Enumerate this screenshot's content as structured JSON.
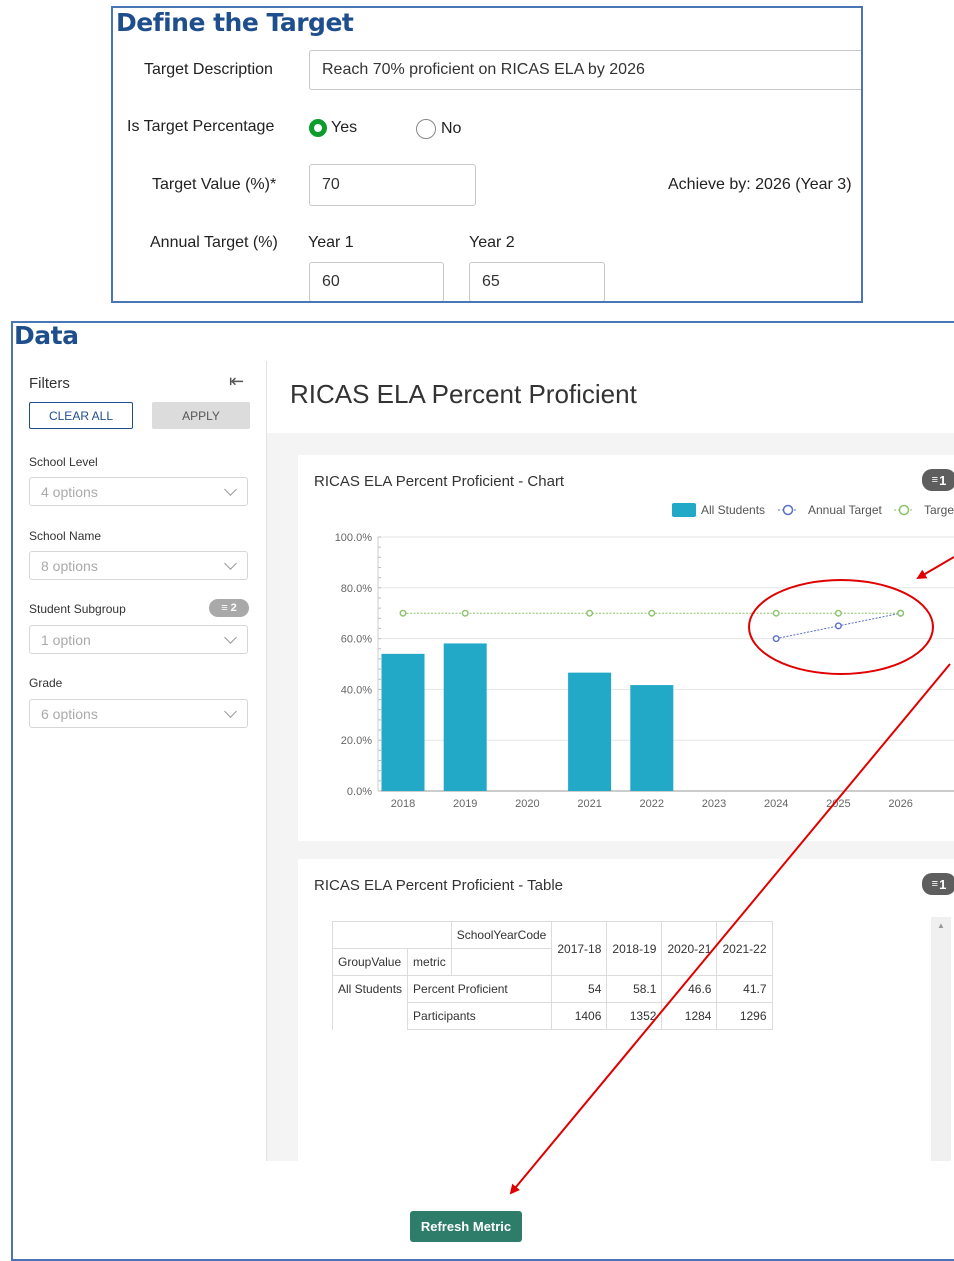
{
  "target": {
    "heading": "Define the Target",
    "description_label": "Target Description",
    "description_value": "Reach 70% proficient on RICAS ELA by 2026",
    "percentage_label": "Is Target Percentage",
    "yes_label": "Yes",
    "no_label": "No",
    "selected": "Yes",
    "value_label": "Target Value (%)*",
    "value": "70",
    "achieve_by": "Achieve by: 2026 (Year 3)",
    "annual_label": "Annual Target (%)",
    "years": [
      {
        "label": "Year 1",
        "value": "60"
      },
      {
        "label": "Year 2",
        "value": "65"
      }
    ]
  },
  "data_section": {
    "heading": "Data",
    "filters": {
      "title": "Filters",
      "clear_all": "CLEAR ALL",
      "apply": "APPLY",
      "groups": [
        {
          "label": "School Level",
          "value": "4 options"
        },
        {
          "label": "School Name",
          "value": "8 options"
        },
        {
          "label": "Student Subgroup",
          "value": "1 option",
          "badge": "2"
        },
        {
          "label": "Grade",
          "value": "6 options"
        }
      ]
    },
    "page_title": "RICAS ELA Percent Proficient",
    "chart_title": "RICAS ELA Percent Proficient - Chart",
    "chart_filter_count": "1",
    "table_title": "RICAS ELA Percent Proficient - Table",
    "table_filter_count": "1",
    "table": {
      "corner_header": "SchoolYearCode",
      "row_headers": [
        "GroupValue",
        "metric"
      ],
      "columns": [
        "2017-18",
        "2018-19",
        "2020-21",
        "2021-22"
      ],
      "group": "All Students",
      "rows": [
        {
          "metric": "Percent Proficient",
          "values": [
            "54",
            "58.1",
            "46.6",
            "41.7"
          ]
        },
        {
          "metric": "Participants",
          "values": [
            "1406",
            "1352",
            "1284",
            "1296"
          ]
        }
      ]
    },
    "refresh_label": "Refresh Metric"
  },
  "colors": {
    "bar": "#21a9c7",
    "annual_target": "#5b6ec8",
    "target": "#8cc36b",
    "annotation": "#e00000",
    "heading": "#1f4e8c",
    "refresh_button": "#2e7d6b"
  },
  "chart_data": {
    "type": "bar",
    "title": "RICAS ELA Percent Proficient - Chart",
    "categories": [
      "2018",
      "2019",
      "2020",
      "2021",
      "2022",
      "2023",
      "2024",
      "2025",
      "2026"
    ],
    "ylim": [
      0,
      100
    ],
    "y_ticks": [
      "0.0%",
      "20.0%",
      "40.0%",
      "60.0%",
      "80.0%",
      "100.0%"
    ],
    "series": [
      {
        "name": "All Students",
        "kind": "bar",
        "values": [
          54,
          58.1,
          null,
          46.6,
          41.7,
          null,
          null,
          null,
          null
        ]
      },
      {
        "name": "Annual Target",
        "kind": "line",
        "values": [
          null,
          null,
          null,
          null,
          null,
          null,
          60,
          65,
          70
        ]
      },
      {
        "name": "Target",
        "kind": "line",
        "values": [
          70,
          70,
          null,
          70,
          70,
          null,
          70,
          70,
          70
        ]
      }
    ],
    "legend_position": "top-right"
  }
}
